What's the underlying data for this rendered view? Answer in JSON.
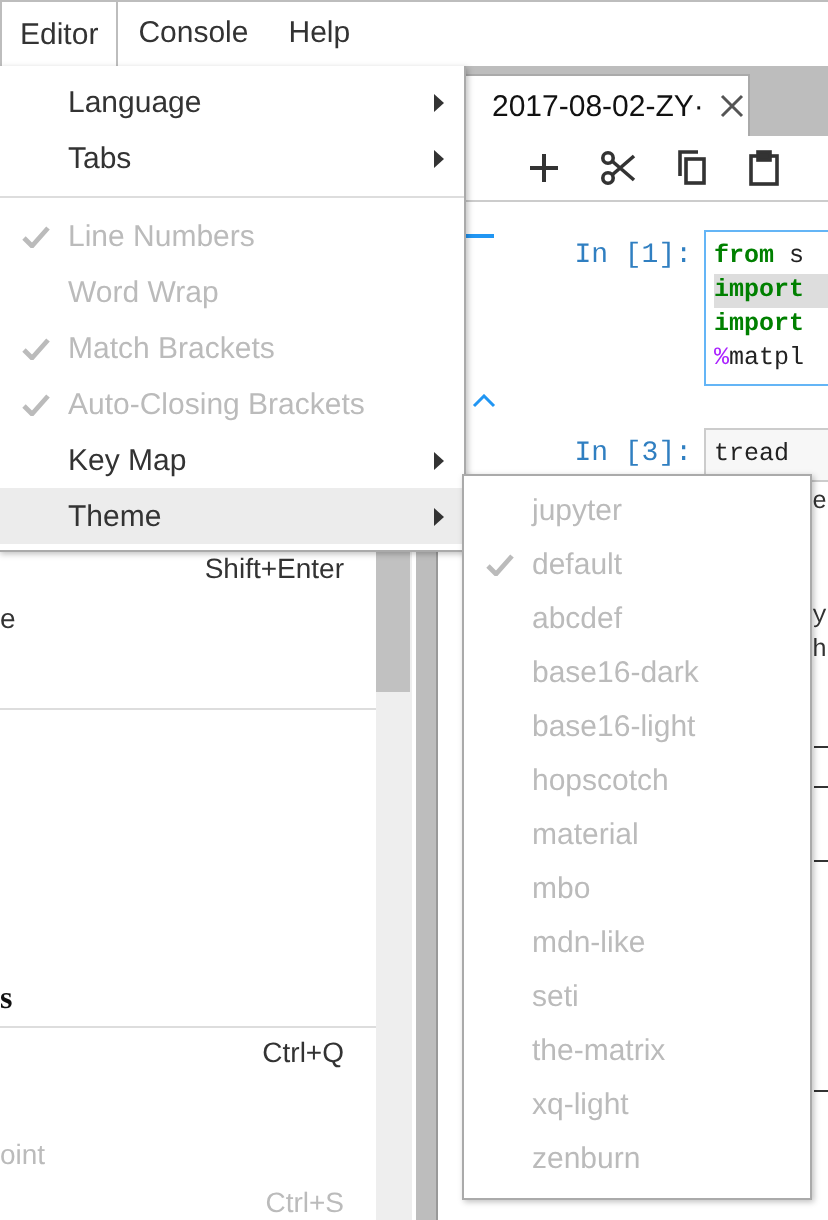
{
  "menubar": [
    {
      "label": "Editor",
      "selected": true
    },
    {
      "label": "Console",
      "selected": false
    },
    {
      "label": "Help",
      "selected": false
    }
  ],
  "left_panel": {
    "shortcut_1": "Shift+Enter",
    "fragment_1": "e",
    "heading_fragment": "s",
    "shortcut_2": "Ctrl+Q",
    "fragment_2": "oint",
    "shortcut_3": "Ctrl+S"
  },
  "notebook": {
    "tab": {
      "title": "2017-08-02-ZY·"
    },
    "cells": [
      {
        "prompt": "In [1]:",
        "active": true,
        "lines": [
          {
            "highlighted": false,
            "segments": [
              {
                "kind": "keyword",
                "text": "from"
              },
              {
                "kind": "plain",
                "text": " s"
              }
            ]
          },
          {
            "highlighted": true,
            "segments": [
              {
                "kind": "keyword",
                "text": "import"
              }
            ]
          },
          {
            "highlighted": false,
            "segments": [
              {
                "kind": "keyword",
                "text": "import"
              }
            ]
          },
          {
            "highlighted": false,
            "segments": [
              {
                "kind": "magic",
                "text": "%"
              },
              {
                "kind": "plain",
                "text": "matpl"
              }
            ]
          }
        ]
      },
      {
        "prompt": "In [3]:",
        "active": false,
        "lines": [
          {
            "highlighted": false,
            "segments": [
              {
                "kind": "plain",
                "text": "tread"
              }
            ]
          }
        ],
        "output": [
          "e",
          "y",
          "h"
        ]
      }
    ]
  },
  "editor_menu": {
    "items": [
      {
        "kind": "submenu",
        "label": "Language",
        "disabled": false,
        "selected": false
      },
      {
        "kind": "submenu",
        "label": "Tabs",
        "disabled": false,
        "selected": false
      },
      {
        "kind": "separator"
      },
      {
        "kind": "toggle",
        "label": "Line Numbers",
        "checked": true,
        "disabled": true
      },
      {
        "kind": "toggle",
        "label": "Word Wrap",
        "checked": false,
        "disabled": true
      },
      {
        "kind": "toggle",
        "label": "Match Brackets",
        "checked": true,
        "disabled": true
      },
      {
        "kind": "toggle",
        "label": "Auto-Closing Brackets",
        "checked": true,
        "disabled": true
      },
      {
        "kind": "submenu",
        "label": "Key Map",
        "disabled": false,
        "selected": false
      },
      {
        "kind": "submenu",
        "label": "Theme",
        "disabled": false,
        "selected": true
      }
    ]
  },
  "theme_menu": {
    "items": [
      {
        "label": "jupyter",
        "checked": false,
        "disabled": true
      },
      {
        "label": "default",
        "checked": true,
        "disabled": true
      },
      {
        "label": "abcdef",
        "checked": false,
        "disabled": true
      },
      {
        "label": "base16-dark",
        "checked": false,
        "disabled": true
      },
      {
        "label": "base16-light",
        "checked": false,
        "disabled": true
      },
      {
        "label": "hopscotch",
        "checked": false,
        "disabled": true
      },
      {
        "label": "material",
        "checked": false,
        "disabled": true
      },
      {
        "label": "mbo",
        "checked": false,
        "disabled": true
      },
      {
        "label": "mdn-like",
        "checked": false,
        "disabled": true
      },
      {
        "label": "seti",
        "checked": false,
        "disabled": true
      },
      {
        "label": "the-matrix",
        "checked": false,
        "disabled": true
      },
      {
        "label": "xq-light",
        "checked": false,
        "disabled": true
      },
      {
        "label": "zenburn",
        "checked": false,
        "disabled": true
      }
    ]
  }
}
